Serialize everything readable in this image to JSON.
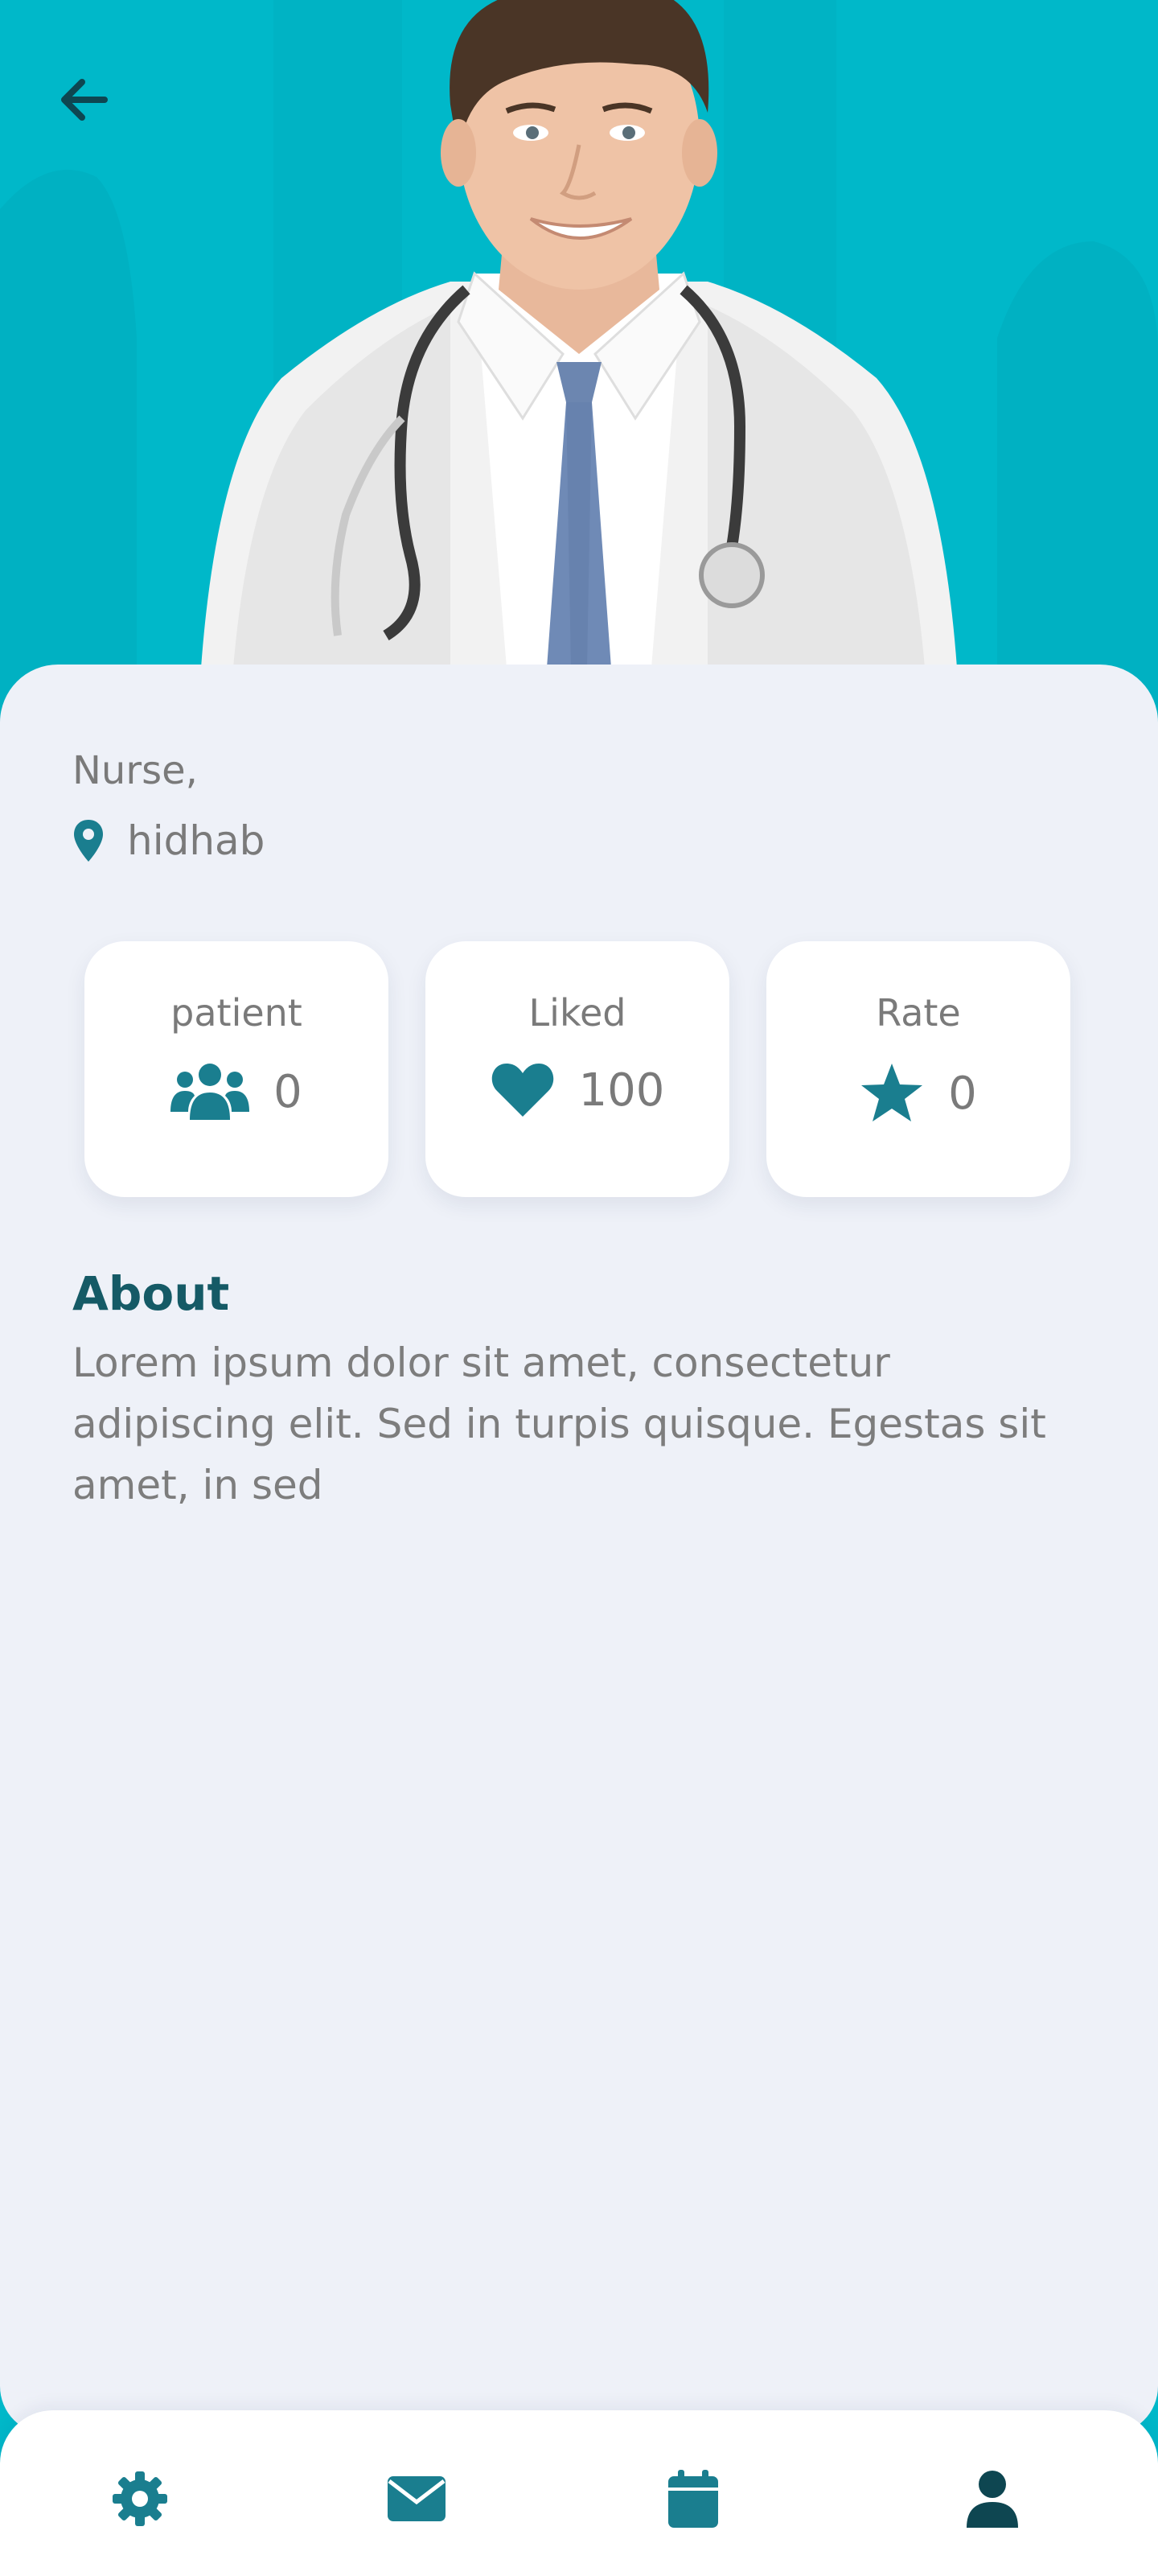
{
  "colors": {
    "hero_bg": "#00b8c9",
    "accent": "#1a7e8f",
    "dark_accent": "#0e4651",
    "text_muted": "#7a7a7a",
    "sheet_bg": "#eef1f8"
  },
  "header": {
    "back_icon": "arrow-left-icon"
  },
  "profile": {
    "role": "Nurse,",
    "location": "hidhab",
    "location_icon": "map-pin-icon"
  },
  "stats": [
    {
      "label": "patient",
      "value": "0",
      "icon": "users-icon"
    },
    {
      "label": "Liked",
      "value": "100",
      "icon": "heart-icon"
    },
    {
      "label": "Rate",
      "value": "0",
      "icon": "star-icon"
    }
  ],
  "about": {
    "title": "About",
    "text": "Lorem ipsum dolor sit amet, consectetur adipiscing elit. Sed in turpis quisque. Egestas sit amet, in sed"
  },
  "nav": {
    "items": [
      {
        "icon": "gear-icon",
        "active": false
      },
      {
        "icon": "envelope-icon",
        "active": false
      },
      {
        "icon": "calendar-icon",
        "active": false
      },
      {
        "icon": "user-icon",
        "active": true
      }
    ]
  }
}
